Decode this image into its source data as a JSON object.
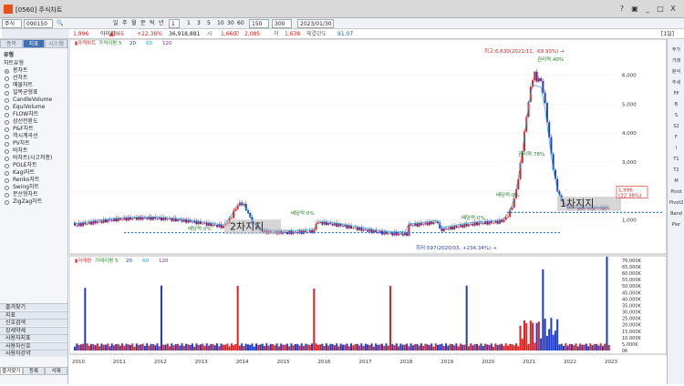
{
  "window": {
    "code": "[0560] 주식차트",
    "close": "X",
    "minimize": "_",
    "restore": "□",
    "help": "?",
    "extra": "▣"
  },
  "toolbar": {
    "market": "주식",
    "code": "090150",
    "mode_buttons": [
      "일",
      "주",
      "월",
      "분",
      "틱",
      "년"
    ],
    "period_label": "1",
    "intervals": [
      "1",
      "3",
      "5",
      "10",
      "30",
      "60"
    ],
    "count1": "150",
    "count2": "300",
    "date": "2023/01/30",
    "zoom_label": "확대"
  },
  "quote": {
    "name": "아이원",
    "price": "1,996",
    "change": "▲365",
    "change_pct": "+22.38%",
    "volume": "36,918,881",
    "f1_label": "시",
    "f1": "1,660",
    "f2_label": "고",
    "f2": "2,085",
    "f3_label": "저",
    "f3": "1,638",
    "f4_label": "체결강도",
    "f4": "91.07",
    "right": "[1일]"
  },
  "sidebar": {
    "tabs": [
      "종목",
      "지표",
      "시스템"
    ],
    "active_tab": 1,
    "group_title": "유형",
    "group_sub": "차트유형",
    "items": [
      "봉차트",
      "선차트",
      "매물차트",
      "일목균형표",
      "CandleVolume",
      "EquiVolume",
      "FLOW차트",
      "삼선전환도",
      "P&F차트",
      "역시계곡선",
      "PV차트",
      "바차트",
      "바차트(시고저종)",
      "POLE차트",
      "Kagi차트",
      "Renko차트",
      "Swing차트",
      "분산형차트",
      "ZigZag차트"
    ],
    "selected": 0,
    "bottom": [
      "즐겨찾기",
      "지표",
      "신호검색",
      "강세약세",
      "사용자지표",
      "사용자신호",
      "사용자강약"
    ],
    "footer_tabs": [
      "즐겨찾기",
      "등록",
      "삭제"
    ]
  },
  "righttools": [
    "주가",
    "거래",
    "분석",
    "추세",
    "FP",
    "B",
    "S",
    "S2",
    "F",
    "I",
    "T1",
    "T2",
    "M",
    "Pivot",
    "Pivot2",
    "Band",
    "Pier"
  ],
  "chart_data": {
    "type": "candlestick",
    "price_legend": [
      "가격차트",
      "가격이평 5",
      "20",
      "60",
      "120"
    ],
    "volume_legend": [
      "거래량",
      "거래이평 5",
      "20",
      "60",
      "120"
    ],
    "x_ticks": [
      "2010",
      "2011",
      "2012",
      "2013",
      "2014",
      "2015",
      "2016",
      "2017",
      "2018",
      "2019",
      "2020",
      "2021",
      "2022",
      "2023"
    ],
    "price_ticks": [
      "6,000",
      "5,000",
      "4,000",
      "3,000",
      "2,000",
      "1,000"
    ],
    "volume_ticks": [
      "70,000K",
      "65,000K",
      "60,000K",
      "55,000K",
      "50,000K",
      "45,000K",
      "40,000K",
      "35,000K",
      "30,000K",
      "25,000K",
      "20,000K",
      "15,000K",
      "10,000K",
      "5,000K",
      "0K"
    ],
    "price_ylim": [
      0,
      7000
    ],
    "volume_ylim": [
      0,
      72000
    ],
    "annotations": {
      "high": "최고:6,630(2021/11, -69.93%) →",
      "low": "최저:597(2020/03, +234.34%) →",
      "rights": "권리락:40%",
      "rights2": "권리락:78%",
      "dividend1": "배당락:0%",
      "dividend2": "배당락:0%",
      "dividend3": "배당락:0%",
      "dividend4": "배당락:0%",
      "support1": "1차지지",
      "support2": "2차지지",
      "last_price": "1,996",
      "last_pct": "(22.38%)"
    }
  }
}
